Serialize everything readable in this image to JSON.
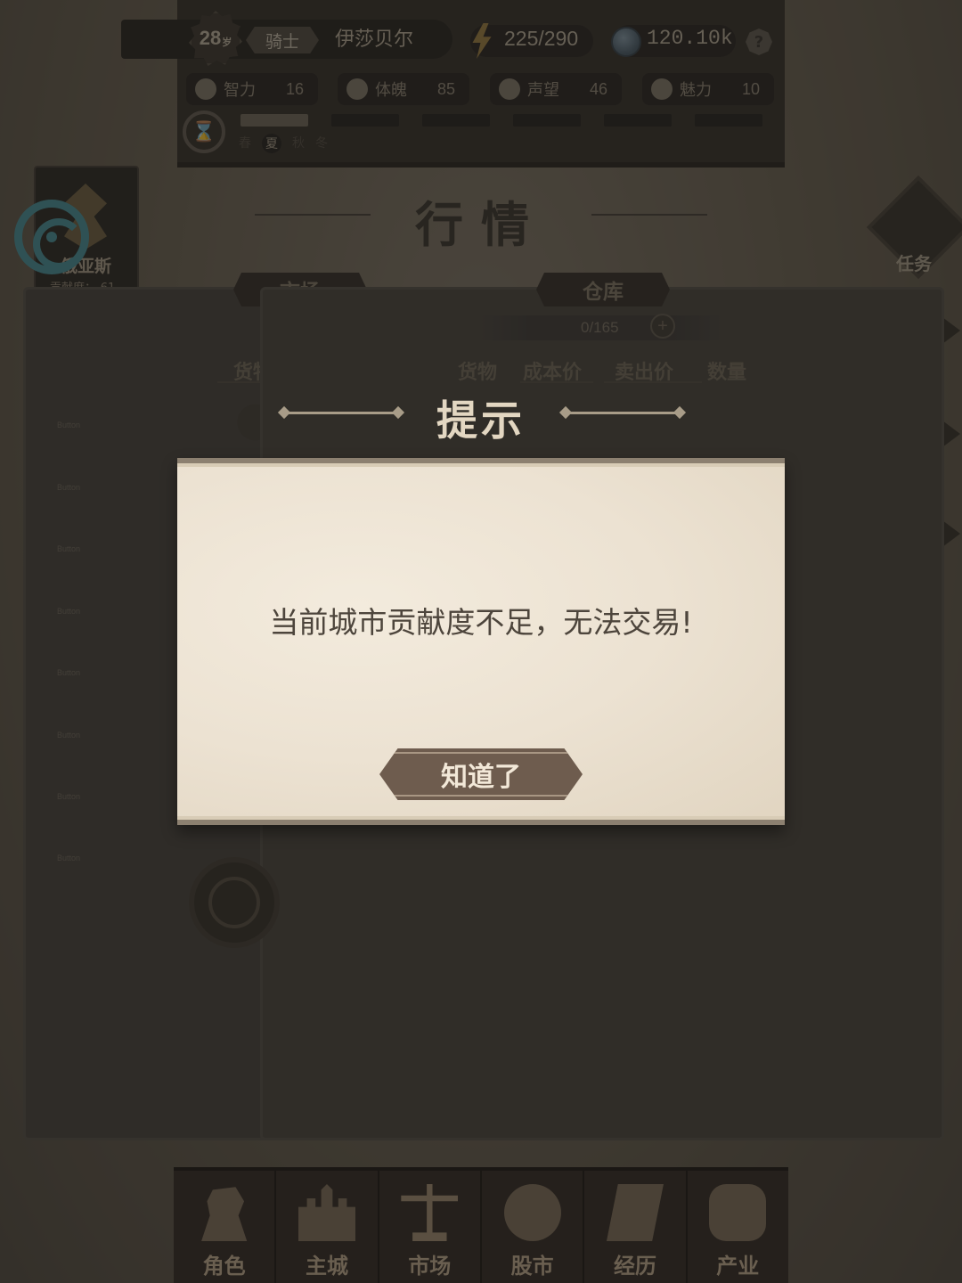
{
  "header": {
    "age": "28",
    "age_unit": "岁",
    "rank": "骑士",
    "player_name": "伊莎贝尔",
    "energy": "225/290",
    "coins": "120.10k",
    "help": "?",
    "stats": [
      {
        "label": "智力",
        "value": "16",
        "icon": "brain-icon"
      },
      {
        "label": "体魄",
        "value": "85",
        "icon": "muscle-icon"
      },
      {
        "label": "声望",
        "value": "46",
        "icon": "fame-icon"
      },
      {
        "label": "魅力",
        "value": "10",
        "icon": "heart-icon"
      }
    ],
    "seasons": [
      "春",
      "夏",
      "秋",
      "冬"
    ],
    "active_season": "夏"
  },
  "page": {
    "title": "行情"
  },
  "city": {
    "name": "俄亚斯",
    "contribution": "贡献度：-61"
  },
  "task": {
    "label": "任务"
  },
  "market": {
    "tab": "市场",
    "goods_header": "货物",
    "buttons": [
      "Button",
      "Button",
      "Button",
      "Button",
      "Button",
      "Button",
      "Button",
      "Button"
    ]
  },
  "warehouse": {
    "tab": "仓库",
    "capacity": "0/165",
    "add_icon": "+",
    "columns": [
      "货物",
      "成本价",
      "卖出价",
      "数量"
    ]
  },
  "dialog": {
    "title": "提示",
    "message": "当前城市贡献度不足，无法交易!",
    "confirm": "知道了"
  },
  "nav": {
    "items": [
      {
        "label": "角色",
        "icon": "role-icon"
      },
      {
        "label": "主城",
        "icon": "castle-icon"
      },
      {
        "label": "市场",
        "icon": "scale-icon"
      },
      {
        "label": "股市",
        "icon": "stock-icon"
      },
      {
        "label": "经历",
        "icon": "scroll-icon"
      },
      {
        "label": "产业",
        "icon": "coins-icon"
      }
    ],
    "active": "市场"
  },
  "colors": {
    "dialog_bg": "#ece2d2",
    "button_bg": "#6e5c4e",
    "accent_teal": "#3f8d98"
  }
}
